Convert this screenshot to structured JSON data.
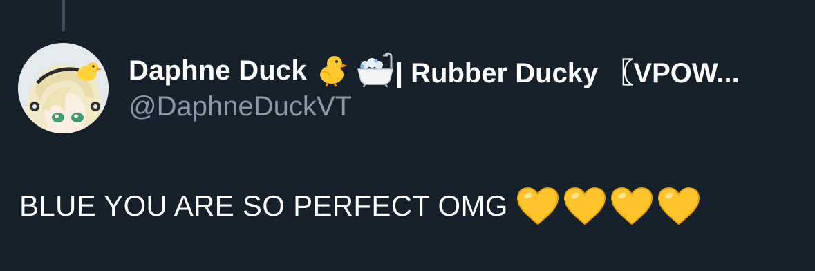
{
  "author": {
    "display_name": "Daphne Duck",
    "name_suffix": "| Rubber Ducky 〖VPOW...",
    "handle": "@DaphneDuckVT",
    "name_emojis": [
      "chick-emoji",
      "bathtub-emoji"
    ]
  },
  "tweet": {
    "text": "BLUE YOU ARE SO PERFECT OMG",
    "emojis": [
      "yellow-heart-emoji",
      "yellow-heart-emoji",
      "yellow-heart-emoji",
      "yellow-heart-emoji"
    ]
  },
  "colors": {
    "background": "#16202b",
    "primary_text": "#ffffff",
    "secondary_text": "#8b98a5",
    "thread_line": "#3d4b58",
    "heart": "#ffc32b"
  }
}
